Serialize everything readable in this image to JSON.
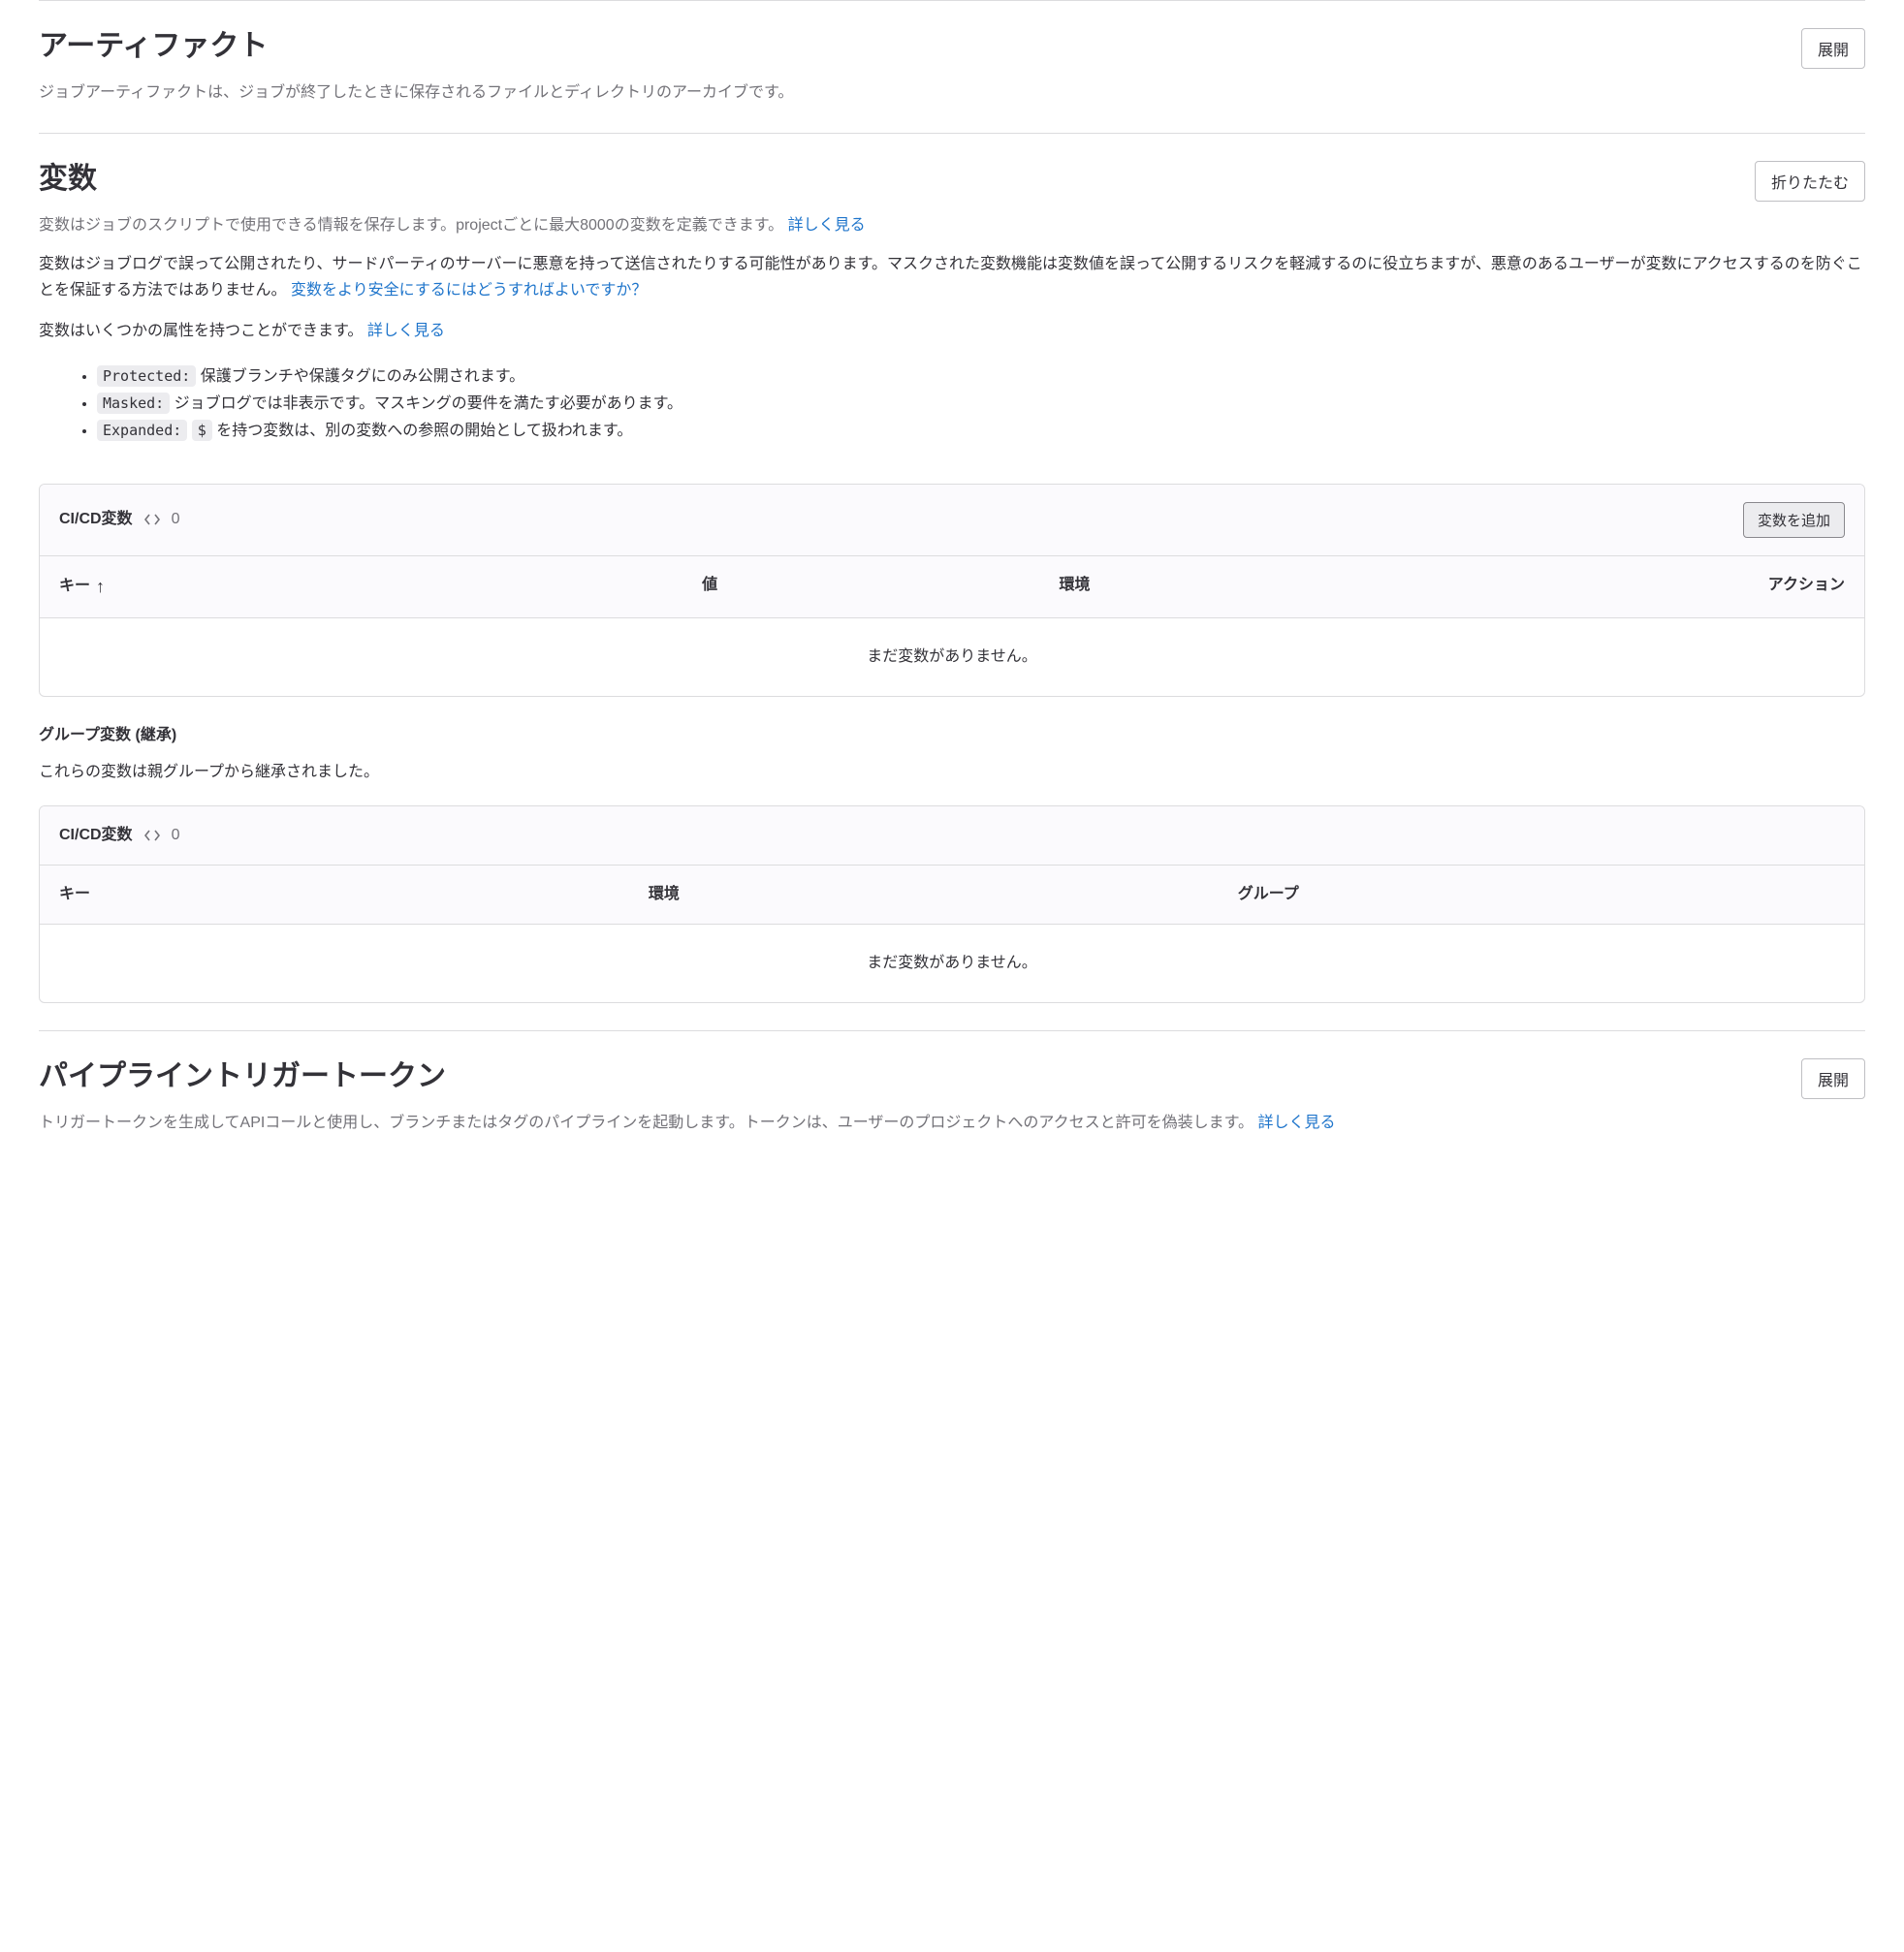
{
  "artifacts": {
    "title": "アーティファクト",
    "toggle": "展開",
    "description": "ジョブアーティファクトは、ジョブが終了したときに保存されるファイルとディレクトリのアーカイブです。"
  },
  "variables": {
    "title": "変数",
    "toggle": "折りたたむ",
    "description_1": "変数はジョブのスクリプトで使用できる情報を保存します。projectごとに最大8000の変数を定義できます。",
    "learn_more_1": "詳しく見る",
    "description_2a": "変数はジョブログで誤って公開されたり、サードパーティのサーバーに悪意を持って送信されたりする可能性があります。マスクされた変数機能は変数値を誤って公開するリスクを軽減するのに役立ちますが、悪意のあるユーザーが変数にアクセスするのを防ぐことを保証する方法ではありません。",
    "secure_link": "変数をより安全にするにはどうすればよいですか？",
    "description_3": "変数はいくつかの属性を持つことができます。",
    "learn_more_3": "詳しく見る",
    "attributes": [
      {
        "tag": "Protected:",
        "text": " 保護ブランチや保護タグにのみ公開されます。"
      },
      {
        "tag": "Masked:",
        "text": " ジョブログでは非表示です。マスキングの要件を満たす必要があります。"
      },
      {
        "tag": "Expanded:",
        "inline_code": "$",
        "text_prefix": " ",
        "text": " を持つ変数は、別の変数への参照の開始として扱われます。"
      }
    ],
    "cicd_card": {
      "title": "CI/CD変数",
      "count": "0",
      "add_button": "変数を追加",
      "columns": {
        "key": "キー",
        "value": "値",
        "environment": "環境",
        "action": "アクション"
      },
      "empty": "まだ変数がありません。"
    },
    "group_section": {
      "title": "グループ変数 (継承)",
      "description": "これらの変数は親グループから継承されました。",
      "card": {
        "title": "CI/CD変数",
        "count": "0",
        "columns": {
          "key": "キー",
          "environment": "環境",
          "group": "グループ"
        },
        "empty": "まだ変数がありません。"
      }
    }
  },
  "triggers": {
    "title": "パイプライントリガートークン",
    "toggle": "展開",
    "description": "トリガートークンを生成してAPIコールと使用し、ブランチまたはタグのパイプラインを起動します。トークンは、ユーザーのプロジェクトへのアクセスと許可を偽装します。",
    "learn_more": "詳しく見る"
  }
}
